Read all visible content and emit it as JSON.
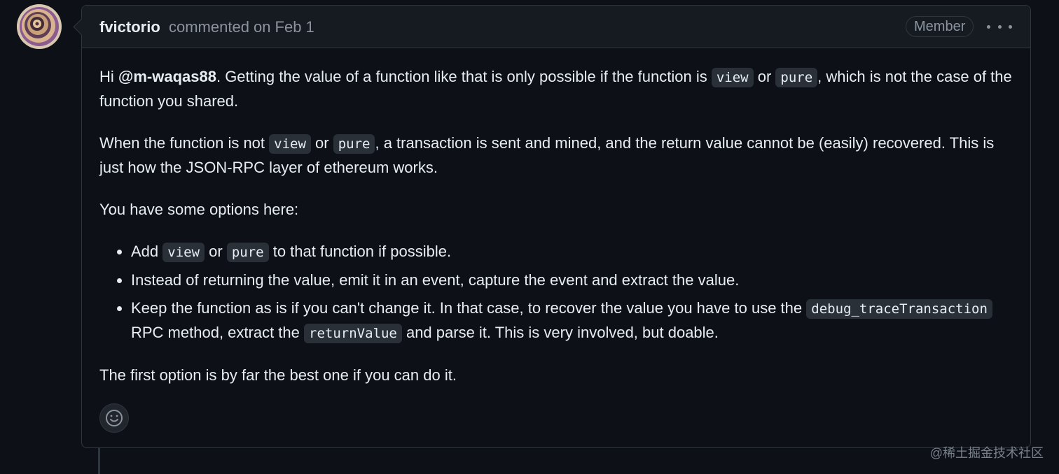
{
  "comment": {
    "author": "fvictorio",
    "meta_action": "commented",
    "meta_date": "on Feb 1",
    "badge": "Member",
    "menu_icon": "kebab-horizontal-icon",
    "body": {
      "p1": {
        "pre": "Hi ",
        "mention": "@m-waqas88",
        "mid": ". Getting the value of a function like that is only possible if the function is ",
        "code_view": "view",
        "or": " or ",
        "code_pure": "pure",
        "post": ", which is not the case of the function you shared."
      },
      "p2": {
        "pre": "When the function is not ",
        "code_view": "view",
        "or": " or ",
        "code_pure": "pure",
        "post": ", a transaction is sent and mined, and the return value cannot be (easily) recovered. This is just how the JSON-RPC layer of ethereum works."
      },
      "p3": "You have some options here:",
      "list": {
        "item1": {
          "pre": "Add ",
          "code_view": "view",
          "or": " or ",
          "code_pure": "pure",
          "post": " to that function if possible."
        },
        "item2": "Instead of returning the value, emit it in an event, capture the event and extract the value.",
        "item3": {
          "pre": "Keep the function as is if you can't change it. In that case, to recover the value you have to use the ",
          "code_debug": "debug_traceTransaction",
          "mid": " RPC method, extract the ",
          "code_return": "returnValue",
          "post": " and parse it. This is very involved, but doable."
        }
      },
      "p4": "The first option is by far the best one if you can do it."
    },
    "reaction_icon": "smiley-icon"
  },
  "watermark": "@稀土掘金技术社区",
  "colors": {
    "background": "#0d1117",
    "header_background": "#161b22",
    "border": "#30363d",
    "text": "#e6edf3",
    "muted": "#8b949e",
    "code_background": "#2a3037"
  }
}
